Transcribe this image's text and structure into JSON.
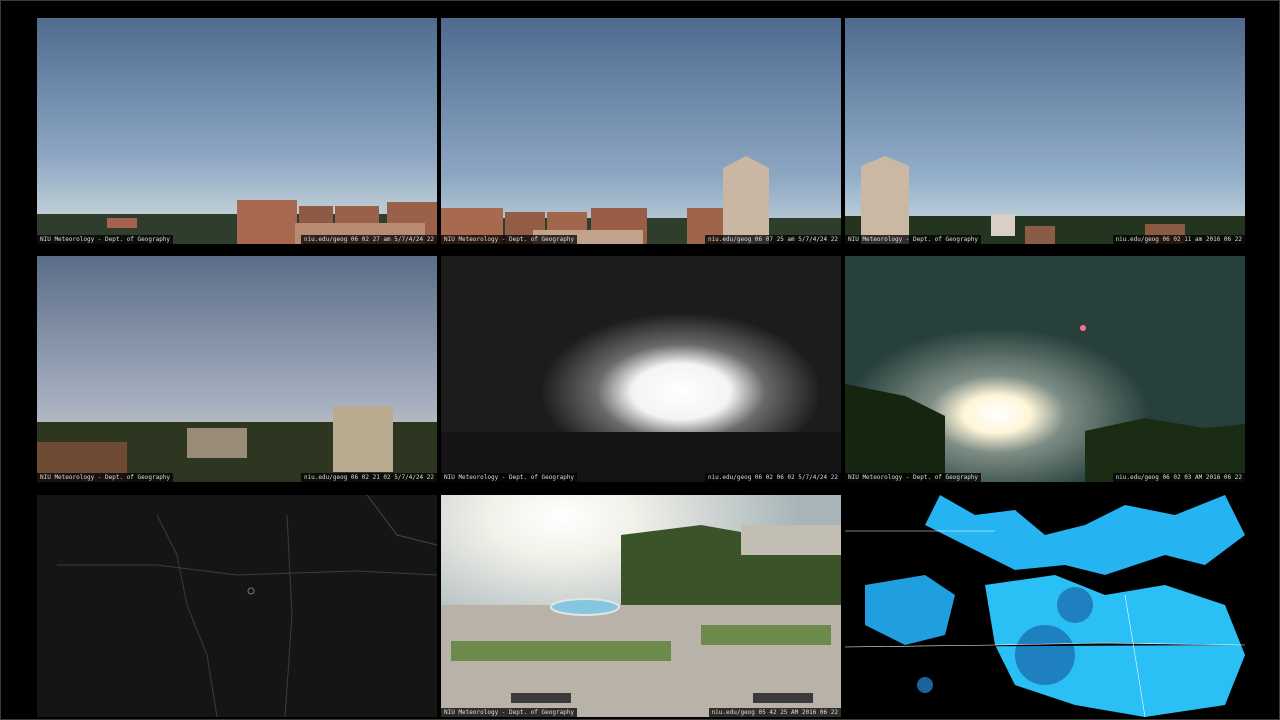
{
  "cams": [
    {
      "name": "cam-1",
      "caption_left": "NIU Meteorology - Dept. of Geography",
      "caption_right": "niu.edu/geog 06 02 27 am 5/7/4/24 22"
    },
    {
      "name": "cam-2",
      "caption_left": "NIU Meteorology - Dept. of Geography",
      "caption_right": "niu.edu/geog 06 07 25 am 5/7/4/24 22"
    },
    {
      "name": "cam-3",
      "caption_left": "NIU Meteorology - Dept. of Geography",
      "caption_right": "niu.edu/geog 06 02 11 am 2016 06 22"
    },
    {
      "name": "cam-4",
      "caption_left": "NIU Meteorology - Dept. of Geography",
      "caption_right": "niu.edu/geog 06 02 21 02 5/7/4/24 22"
    },
    {
      "name": "cam-5",
      "caption_left": "NIU Meteorology - Dept. of Geography",
      "caption_right": "niu.edu/geog 06 02 06 02 5/7/4/24 22"
    },
    {
      "name": "cam-6",
      "caption_left": "NIU Meteorology - Dept. of Geography",
      "caption_right": "niu.edu/geog 06 02 03 AM 2016 06 22"
    },
    {
      "name": "satellite",
      "caption_left": "",
      "caption_right": ""
    },
    {
      "name": "cam-8",
      "caption_left": "NIU Meteorology - Dept. of Geography",
      "caption_right": "niu.edu/geog 05 42 25 AM 2016 06 22"
    },
    {
      "name": "radar",
      "caption_left": "",
      "caption_right": ""
    }
  ],
  "colors": {
    "sky_top": "#6f86a8",
    "sky_bottom": "#c8d4d8",
    "brick": "#a56b52",
    "radar": "#2fd8ff"
  }
}
